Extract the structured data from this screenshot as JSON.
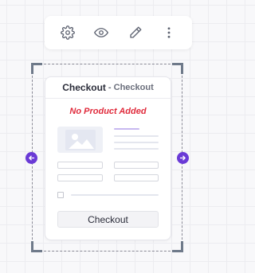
{
  "toolbar": {
    "icons": [
      "settings-icon",
      "eye-icon",
      "pencil-icon",
      "more-vertical-icon"
    ]
  },
  "widget": {
    "title": "Checkout",
    "subtitle": "- Checkout",
    "empty_message": "No Product Added",
    "button_label": "Checkout"
  },
  "colors": {
    "accent": "#6a3ad6",
    "error": "#e02b3c"
  }
}
